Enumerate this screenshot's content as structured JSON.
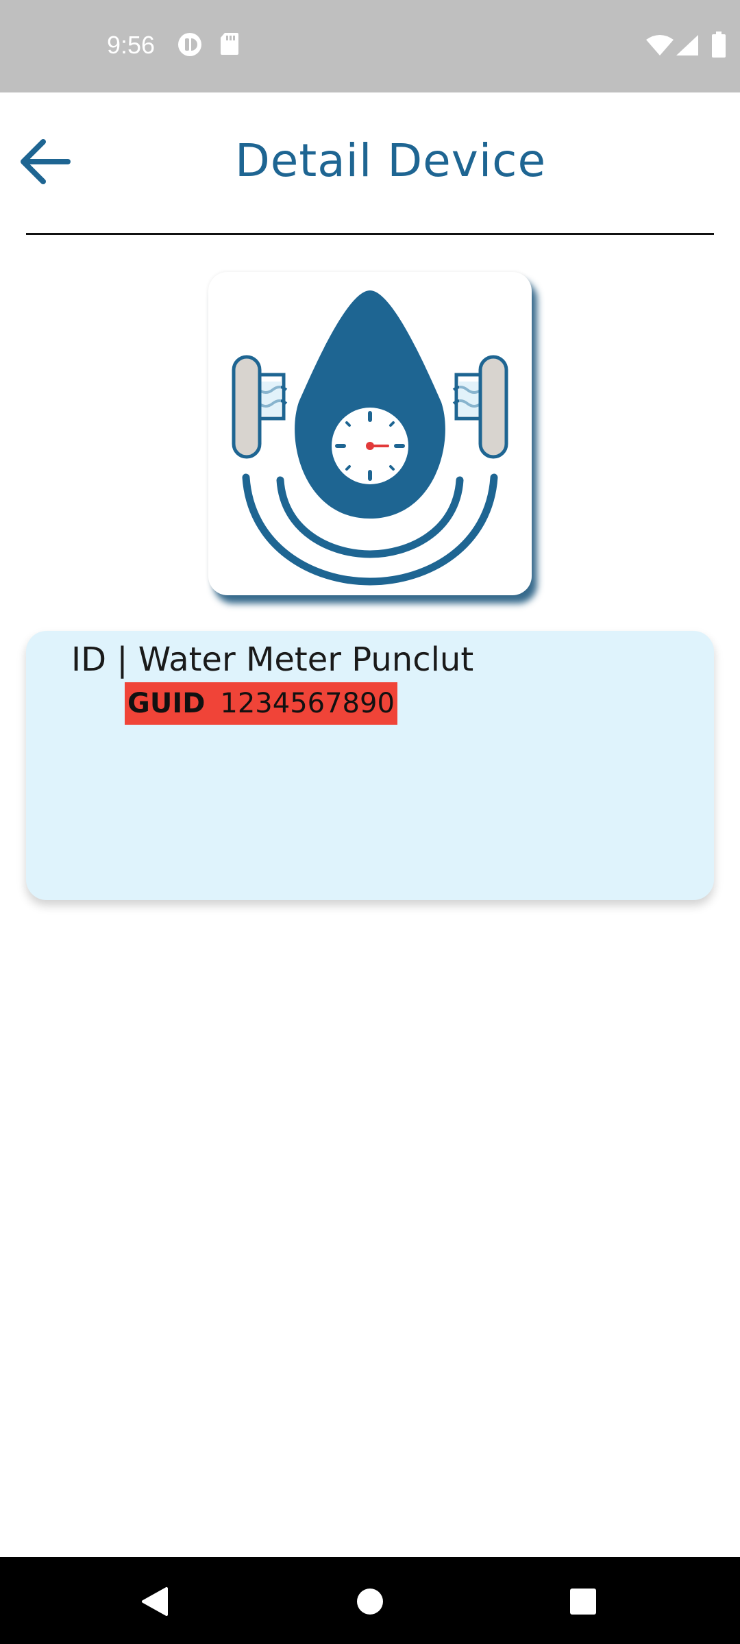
{
  "status_bar": {
    "time": "9:56",
    "icons": [
      "cast-icon",
      "sd-card-icon",
      "wifi-icon",
      "signal-icon",
      "battery-icon"
    ]
  },
  "header": {
    "title": "Detail Device",
    "back_icon": "arrow-left-icon",
    "accent_color": "#1e6592"
  },
  "device": {
    "image_icon": "water-meter-icon",
    "name": "ID | Water Meter Punclut",
    "guid_label": "GUID",
    "guid_value": "1234567890",
    "guid_badge_color": "#f04438",
    "card_color": "#dff3fc"
  },
  "nav_bar": {
    "buttons": [
      "back-nav-icon",
      "home-nav-icon",
      "recents-nav-icon"
    ]
  }
}
